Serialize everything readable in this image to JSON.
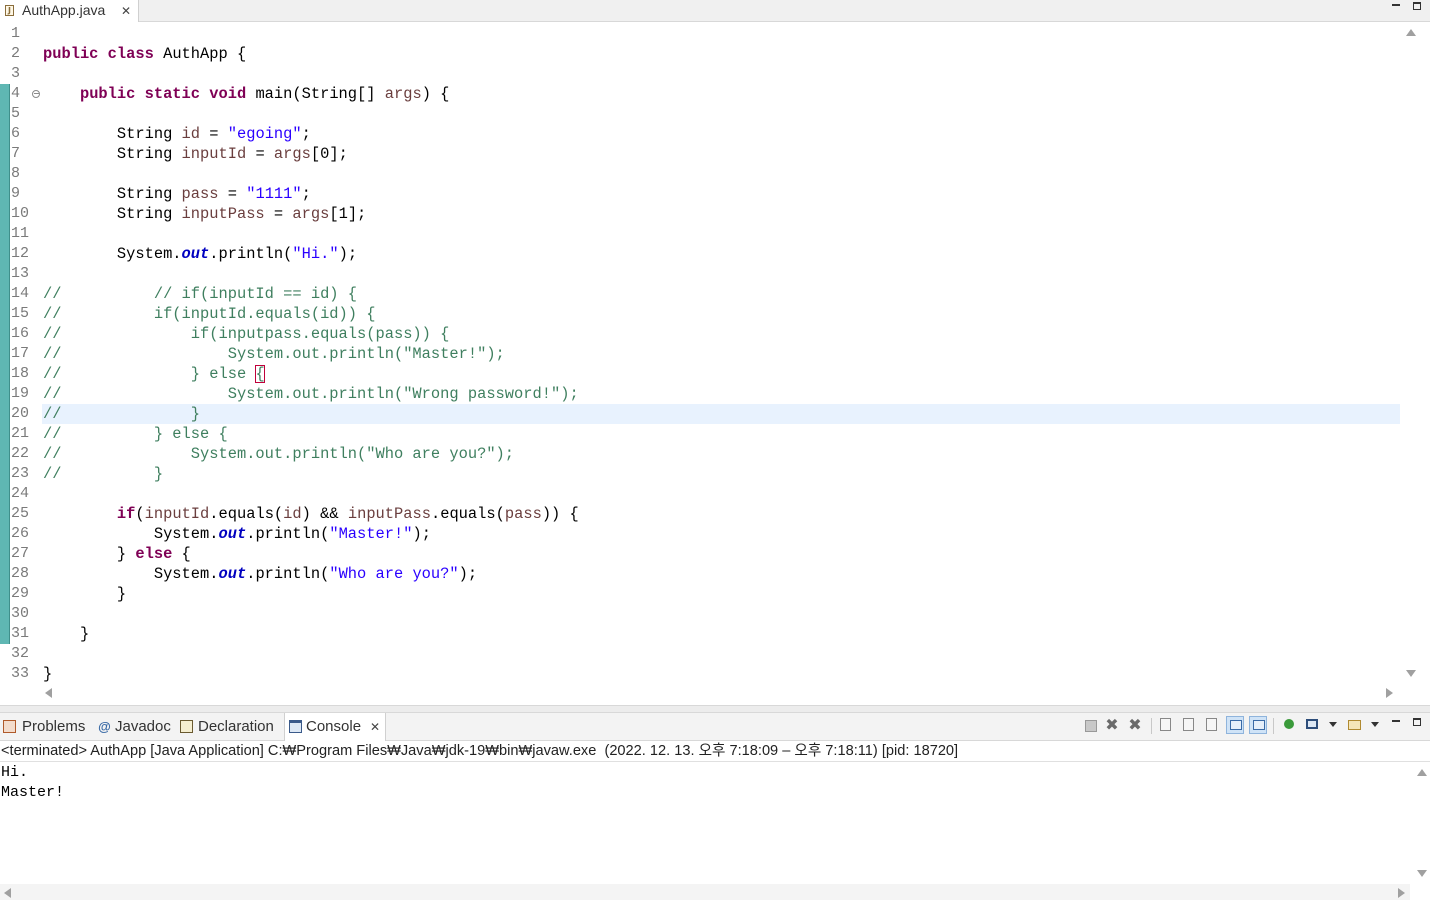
{
  "editor_tab": {
    "label": "AuthApp.java",
    "close": "✕"
  },
  "line_numbers": [
    "1",
    "2",
    "3",
    "4",
    "5",
    "6",
    "7",
    "8",
    "9",
    "10",
    "11",
    "12",
    "13",
    "14",
    "15",
    "16",
    "17",
    "18",
    "19",
    "20",
    "21",
    "22",
    "23",
    "24",
    "25",
    "26",
    "27",
    "28",
    "29",
    "30",
    "31",
    "32",
    "33"
  ],
  "fold_marker": "−",
  "code_tokens": {
    "l2_kw": "public class",
    "l2_rest": " AuthApp {",
    "l4_indent": "    ",
    "l4_kw": "public static void",
    "l4_a": " main(String[] ",
    "l4_var": "args",
    "l4_b": ") {",
    "l6_a": "        String ",
    "l6_var": "id",
    "l6_b": " = ",
    "l6_str": "\"egoing\"",
    "l6_c": ";",
    "l7_a": "        String ",
    "l7_var": "inputId",
    "l7_b": " = ",
    "l7_var2": "args",
    "l7_c": "[0];",
    "l9_a": "        String ",
    "l9_var": "pass",
    "l9_b": " = ",
    "l9_str": "\"1111\"",
    "l9_c": ";",
    "l10_a": "        String ",
    "l10_var": "inputPass",
    "l10_b": " = ",
    "l10_var2": "args",
    "l10_c": "[1];",
    "l12_a": "        System.",
    "l12_fld": "out",
    "l12_b": ".println(",
    "l12_str": "\"Hi.\"",
    "l12_c": ");",
    "l14": "//          // if(inputId == id) {",
    "l15": "//          if(inputId.equals(id)) {",
    "l16": "//              if(inputpass.equals(pass)) {",
    "l17": "//                  System.out.println(\"Master!\");",
    "l18_a": "//              } else ",
    "l18_br": "{",
    "l19": "//                  System.out.println(\"Wrong password!\");",
    "l20": "//              }",
    "l21": "//          } else {",
    "l22": "//              System.out.println(\"Who are you?\");",
    "l23": "//          }",
    "l25_a": "        ",
    "l25_kw": "if",
    "l25_b": "(",
    "l25_var": "inputId",
    "l25_c": ".equals(",
    "l25_var2": "id",
    "l25_d": ") && ",
    "l25_var3": "inputPass",
    "l25_e": ".equals(",
    "l25_var4": "pass",
    "l25_f": ")) {",
    "l26_a": "            System.",
    "l26_fld": "out",
    "l26_b": ".println(",
    "l26_str": "\"Master!\"",
    "l26_c": ");",
    "l27_a": "        } ",
    "l27_kw": "else",
    "l27_b": " {",
    "l28_a": "            System.",
    "l28_fld": "out",
    "l28_b": ".println(",
    "l28_str": "\"Who are you?\"",
    "l28_c": ");",
    "l29": "        }",
    "l31": "    }",
    "l33": "}"
  },
  "panel_tabs": {
    "problems": "Problems",
    "javadoc_icon": "@",
    "javadoc": "Javadoc",
    "declaration": "Declaration",
    "console": "Console",
    "console_close": "✕"
  },
  "console": {
    "status": "<terminated> AuthApp [Java Application] C:₩Program Files₩Java₩jdk-19₩bin₩javaw.exe  (2022. 12. 13. 오후 7:18:09 – 오후 7:18:11) [pid: 18720]",
    "output": [
      "Hi.",
      "Master!"
    ]
  },
  "toolbar": {
    "remove_launch": "✖",
    "remove_all": "✖"
  },
  "icons": {
    "java_file": "java-file-icon",
    "problems": "problems-icon",
    "javadoc": "javadoc-icon",
    "declaration": "declaration-icon",
    "console": "console-icon"
  },
  "colors": {
    "keyword": "#7f0055",
    "string": "#2a00ff",
    "local_variable": "#6a3e3e",
    "static_field": "#0000c0",
    "comment": "#3f7f5f",
    "current_line": "#e8f2fe",
    "change_ruler": "#5fb7b3"
  }
}
